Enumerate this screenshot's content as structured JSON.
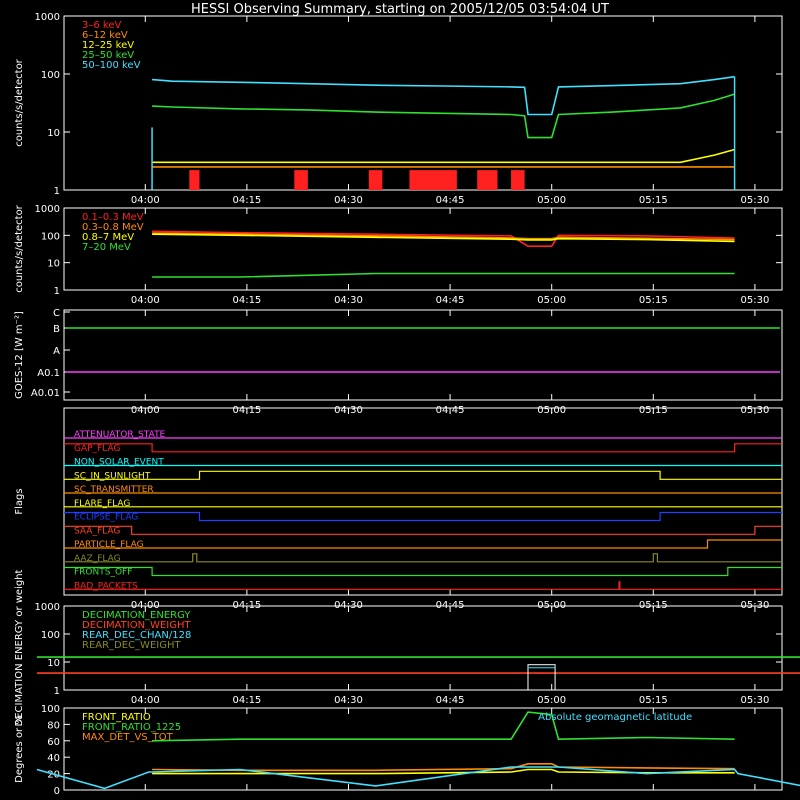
{
  "title": "HESSI Observing Summary, starting on 2005/12/05 03:54:04 UT",
  "colors": {
    "background": "#000000",
    "axes": "#ffffff"
  },
  "time_ticks": [
    "04:00",
    "04:15",
    "04:30",
    "04:45",
    "05:00",
    "05:15",
    "05:30"
  ],
  "chart_data": [
    {
      "type": "line",
      "id": "lo",
      "ylabel": "counts/s/detector",
      "yscale": "log",
      "ylim": [
        1,
        1000
      ],
      "yticks": [
        "1",
        "10",
        "100",
        "1000"
      ],
      "legend_position": "top-left",
      "legend": [
        {
          "name": "3–6 keV",
          "color": "#ff2020"
        },
        {
          "name": "6–12 keV",
          "color": "#ff8c00"
        },
        {
          "name": "12–25 keV",
          "color": "#ffff00"
        },
        {
          "name": "25–50 keV",
          "color": "#30e030"
        },
        {
          "name": "50–100 keV",
          "color": "#40e0ff"
        }
      ],
      "x_minutes": [
        4,
        6.5,
        7,
        10,
        20,
        30,
        40,
        50,
        60,
        62,
        62.5,
        66,
        67,
        75,
        85,
        90,
        93,
        93.5,
        100
      ],
      "series": [
        {
          "name": "50–100 keV",
          "color": "#40e0ff",
          "values": [
            null,
            null,
            80,
            75,
            72,
            68,
            64,
            62,
            60,
            59,
            20,
            20,
            60,
            63,
            68,
            80,
            90,
            null,
            null
          ]
        },
        {
          "name": "25–50 keV",
          "color": "#30e030",
          "values": [
            null,
            null,
            28,
            27,
            25,
            24,
            22,
            21,
            20,
            19,
            8,
            8,
            20,
            22,
            26,
            35,
            45,
            null,
            null
          ]
        },
        {
          "name": "12–25 keV",
          "color": "#ffff00",
          "values": [
            null,
            null,
            3,
            3,
            3,
            3,
            3,
            3,
            3,
            3,
            3,
            3,
            3,
            3,
            3,
            4,
            5,
            null,
            null
          ]
        },
        {
          "name": "6–12 keV",
          "color": "#ff8c00",
          "values": [
            null,
            null,
            2.5,
            2.5,
            2.5,
            2.5,
            2.5,
            2.5,
            2.5,
            2.5,
            2.5,
            2.5,
            2.5,
            2.5,
            2.5,
            2.5,
            2.5,
            null,
            null
          ]
        }
      ]
    },
    {
      "type": "line",
      "id": "hi",
      "ylabel": "counts/s/detector",
      "yscale": "log",
      "ylim": [
        1,
        1000
      ],
      "yticks": [
        "1",
        "10",
        "100",
        "1000"
      ],
      "legend_position": "top-left",
      "legend": [
        {
          "name": "0.1–0.3 MeV",
          "color": "#ff2020"
        },
        {
          "name": "0.3–0.8 MeV",
          "color": "#ff8c00"
        },
        {
          "name": "0.8–7 MeV",
          "color": "#ffff00"
        },
        {
          "name": "7–20 MeV",
          "color": "#30e030"
        }
      ],
      "x_minutes": [
        6.5,
        7,
        20,
        40,
        60,
        62.5,
        66,
        67,
        80,
        93,
        93.5
      ],
      "series": [
        {
          "name": "0.1–0.3 MeV",
          "color": "#ff2020",
          "values": [
            null,
            140,
            125,
            110,
            95,
            40,
            40,
            100,
            95,
            80,
            null
          ]
        },
        {
          "name": "0.3–0.8 MeV",
          "color": "#ff8c00",
          "values": [
            null,
            120,
            110,
            95,
            80,
            75,
            75,
            85,
            78,
            70,
            null
          ]
        },
        {
          "name": "0.8–7 MeV",
          "color": "#ffff00",
          "values": [
            null,
            110,
            100,
            85,
            72,
            68,
            68,
            75,
            70,
            60,
            null
          ]
        },
        {
          "name": "7–20 MeV",
          "color": "#30e030",
          "values": [
            null,
            3,
            3,
            4,
            4,
            4,
            4,
            4,
            4,
            4,
            null
          ]
        }
      ]
    },
    {
      "type": "line",
      "id": "goes",
      "ylabel": "GOES-12 [W m⁻²]",
      "yscale": "log",
      "yticks": [
        "A0.01",
        "A0.1",
        "A",
        "B",
        "C"
      ],
      "series": [
        {
          "name": "GOES long",
          "color": "#30e030",
          "level": "B"
        },
        {
          "name": "GOES short",
          "color": "#ff40ff",
          "level": "A0.1"
        }
      ]
    },
    {
      "type": "flags",
      "id": "flags",
      "ylabel": "Flags",
      "rows": [
        {
          "name": "ATTENUATOR_STATE",
          "color": "#ff40ff",
          "segments": [
            [
              -10,
              105,
              0
            ]
          ]
        },
        {
          "name": "GAP_FLAG",
          "color": "#ff2020",
          "segments": [
            [
              -10,
              7,
              1
            ],
            [
              7,
              93,
              0
            ],
            [
              93,
              105,
              1
            ]
          ]
        },
        {
          "name": "NON_SOLAR_EVENT",
          "color": "#00ffff",
          "segments": [
            [
              -10,
              105,
              0
            ]
          ]
        },
        {
          "name": "SC_IN_SUNLIGHT",
          "color": "#ffff00",
          "segments": [
            [
              -10,
              14,
              0
            ],
            [
              14,
              82,
              1
            ],
            [
              82,
              105,
              0
            ]
          ]
        },
        {
          "name": "SC_TRANSMITTER",
          "color": "#ff8c00",
          "segments": [
            [
              -10,
              105,
              0
            ]
          ]
        },
        {
          "name": "FLARE_FLAG",
          "color": "#ffff00",
          "segments": [
            [
              -10,
              105,
              0
            ]
          ]
        },
        {
          "name": "ECLIPSE_FLAG",
          "color": "#2040ff",
          "segments": [
            [
              -10,
              14,
              1
            ],
            [
              14,
              82,
              0
            ],
            [
              82,
              105,
              1
            ]
          ]
        },
        {
          "name": "SAA_FLAG",
          "color": "#ff4020",
          "segments": [
            [
              -10,
              4,
              1
            ],
            [
              4,
              96,
              0
            ],
            [
              96,
              105,
              1
            ]
          ]
        },
        {
          "name": "PARTICLE_FLAG",
          "color": "#ff8c00",
          "segments": [
            [
              -10,
              89,
              0
            ],
            [
              89,
              105,
              1
            ]
          ]
        },
        {
          "name": "AAZ_FLAG",
          "color": "#8a8a20",
          "segments": [
            [
              -10,
              13,
              0
            ],
            [
              13,
              13.6,
              1
            ],
            [
              13.6,
              81,
              0
            ],
            [
              81,
              81.6,
              1
            ],
            [
              81.6,
              105,
              0
            ]
          ]
        },
        {
          "name": "FRONTS_OFF",
          "color": "#30e030",
          "segments": [
            [
              -10,
              7,
              1
            ],
            [
              7,
              92,
              0
            ],
            [
              92,
              105,
              1
            ]
          ]
        },
        {
          "name": "BAD_PACKETS",
          "color": "#ff2020",
          "segments": [
            [
              -10,
              105,
              0
            ]
          ],
          "spike": 76
        }
      ]
    },
    {
      "type": "line",
      "id": "dec",
      "ylabel": "DECIMATION ENERGY or weight",
      "yscale": "log",
      "ylim": [
        1,
        1000
      ],
      "yticks": [
        "1",
        "10",
        "100",
        "1000"
      ],
      "legend_position": "top-left",
      "legend": [
        {
          "name": "DECIMATION_ENERGY",
          "color": "#30e030"
        },
        {
          "name": "DECIMATION_WEIGHT",
          "color": "#ff4020"
        },
        {
          "name": "REAR_DEC_CHAN/128",
          "color": "#40e0ff"
        },
        {
          "name": "REAR_DEC_WEIGHT",
          "color": "#8a8a20"
        }
      ],
      "x_minutes": [
        -10,
        105
      ],
      "series": [
        {
          "name": "DECIMATION_ENERGY",
          "color": "#30e030",
          "values": [
            15,
            15
          ]
        },
        {
          "name": "DECIMATION_WEIGHT",
          "color": "#ff4020",
          "values": [
            4,
            4
          ]
        }
      ],
      "box": {
        "x": [
          62.5,
          66.5
        ],
        "values": [
          1,
          8
        ],
        "colors": [
          "#40e0ff",
          "#ffffff"
        ]
      }
    },
    {
      "type": "line",
      "id": "ratio",
      "ylabel": "Degrees or %",
      "yscale": "linear",
      "ylim": [
        0,
        100
      ],
      "yticks": [
        "0",
        "20",
        "40",
        "60",
        "80",
        "100"
      ],
      "legend_position": "top-left",
      "legend": [
        {
          "name": "FRONT_RATIO",
          "color": "#ffff00"
        },
        {
          "name": "FRONT_RATIO_1225",
          "color": "#30e030"
        },
        {
          "name": "MAX_DET_VS_TOT",
          "color": "#ff8c00"
        }
      ],
      "annotation": {
        "text": "Absolute geomagnetic latitude",
        "color": "#40e0ff"
      },
      "x_minutes": [
        -10,
        0,
        6.5,
        7,
        20,
        40,
        60,
        62.5,
        66,
        67,
        80,
        93,
        93.5,
        105
      ],
      "series": [
        {
          "name": "FRONT_RATIO_1225",
          "color": "#30e030",
          "values": [
            null,
            null,
            null,
            60,
            62,
            62,
            62,
            95,
            92,
            62,
            64,
            62,
            null,
            null
          ]
        },
        {
          "name": "MAX_DET_VS_TOT",
          "color": "#ff8c00",
          "values": [
            null,
            null,
            null,
            25,
            24,
            24,
            26,
            32,
            32,
            28,
            27,
            26,
            null,
            null
          ]
        },
        {
          "name": "FRONT_RATIO",
          "color": "#ffff00",
          "values": [
            null,
            null,
            null,
            20,
            20,
            20,
            22,
            25,
            25,
            22,
            21,
            21,
            null,
            null
          ]
        },
        {
          "name": "Absolute geomagnetic latitude",
          "color": "#40e0ff",
          "values": [
            25,
            2,
            22,
            22,
            25,
            5,
            28,
            28,
            28,
            28,
            20,
            25,
            20,
            2
          ]
        }
      ]
    }
  ]
}
